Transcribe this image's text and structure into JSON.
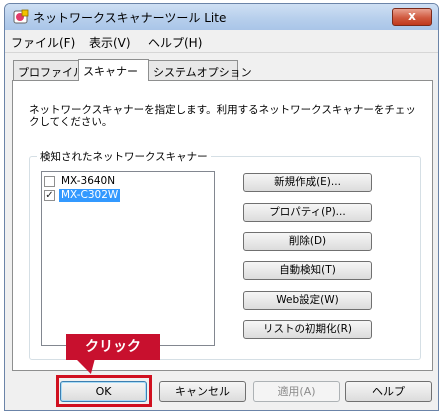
{
  "window": {
    "title": "ネットワークスキャナーツール Lite",
    "close_label": "x"
  },
  "menu": [
    {
      "label": "ファイル(F)"
    },
    {
      "label": "表示(V)"
    },
    {
      "label": "ヘルプ(H)"
    }
  ],
  "tabs": [
    {
      "label": "プロファイル",
      "active": false
    },
    {
      "label": "スキャナー",
      "active": true
    },
    {
      "label": "システムオプション",
      "active": false
    }
  ],
  "panel": {
    "description": "ネットワークスキャナーを指定します。利用するネットワークスキャナーをチェックしてください。",
    "group_title": "検知されたネットワークスキャナー",
    "scanners": [
      {
        "name": "MX-3640N",
        "checked": false,
        "selected": false,
        "check_glyph": ""
      },
      {
        "name": "MX-C302W",
        "checked": true,
        "selected": true,
        "check_glyph": "✓"
      }
    ],
    "buttons": {
      "new": "新規作成(E)...",
      "properties": "プロパティ(P)...",
      "delete": "削除(D)",
      "auto_detect": "自動検知(T)",
      "web_settings": "Web設定(W)",
      "reset_list": "リストの初期化(R)"
    }
  },
  "dialog_buttons": {
    "ok": "OK",
    "cancel": "キャンセル",
    "apply": "適用(A)",
    "help": "ヘルプ"
  },
  "annotation": {
    "callout": "クリック",
    "color": "#c8102e"
  }
}
